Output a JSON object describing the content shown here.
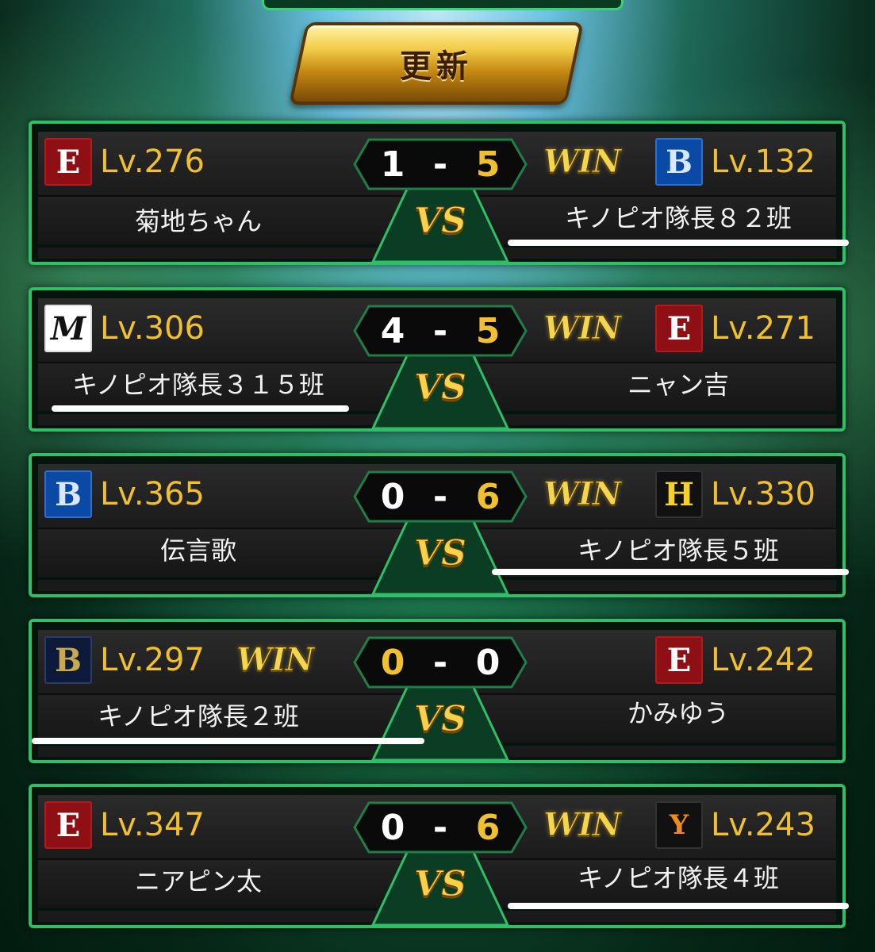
{
  "header": {
    "update_label": "更新"
  },
  "colors": {
    "level": "#f1c02f",
    "score_winner": "#f1c02f",
    "score_loser": "#ffffff",
    "frame": "#2fbf66"
  },
  "vs_label": "VS",
  "win_label": "WIN",
  "matches": [
    {
      "left": {
        "team_icon": "eagles-logo",
        "level": "Lv.276",
        "name": "菊地ちゃん"
      },
      "right": {
        "team_icon": "baystars-logo",
        "level": "Lv.132",
        "name": "キノピオ隊長８２班"
      },
      "score_left": "1",
      "score_right": "5",
      "winner": "right"
    },
    {
      "left": {
        "team_icon": "marines-logo",
        "level": "Lv.306",
        "name": "キノピオ隊長３１５班"
      },
      "right": {
        "team_icon": "eagles-logo",
        "level": "Lv.271",
        "name": "ニャン吉"
      },
      "score_left": "4",
      "score_right": "5",
      "winner": "right"
    },
    {
      "left": {
        "team_icon": "baystars-logo",
        "level": "Lv.365",
        "name": "伝言歌"
      },
      "right": {
        "team_icon": "tigers-logo",
        "level": "Lv.330",
        "name": "キノピオ隊長５班"
      },
      "score_left": "0",
      "score_right": "6",
      "winner": "right"
    },
    {
      "left": {
        "team_icon": "buffaloes-logo",
        "level": "Lv.297",
        "name": "キノピオ隊長２班"
      },
      "right": {
        "team_icon": "eagles-logo",
        "level": "Lv.242",
        "name": "かみゆう"
      },
      "score_left": "0",
      "score_right": "0",
      "winner": "left"
    },
    {
      "left": {
        "team_icon": "eagles-logo",
        "level": "Lv.347",
        "name": "ニアピン太"
      },
      "right": {
        "team_icon": "giants-logo",
        "level": "Lv.243",
        "name": "キノピオ隊長４班"
      },
      "score_left": "0",
      "score_right": "6",
      "winner": "right"
    }
  ]
}
